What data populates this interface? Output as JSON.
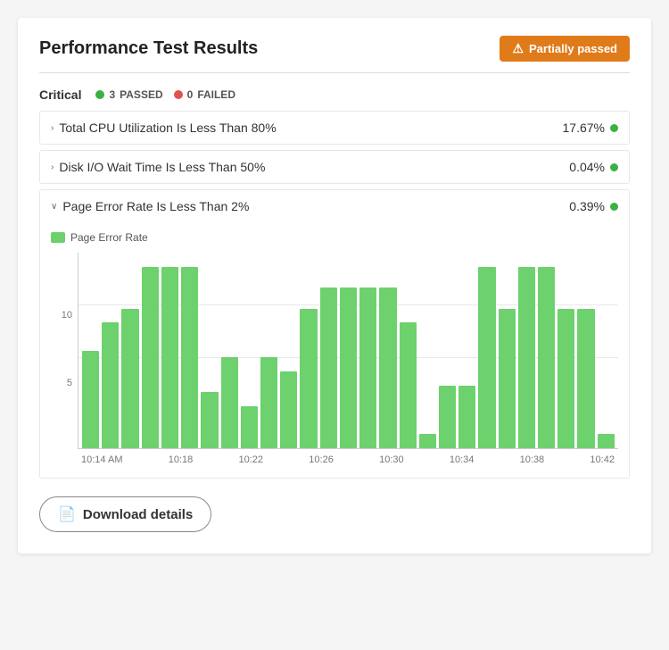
{
  "page": {
    "title": "Performance Test Results"
  },
  "status_badge": {
    "label": "Partially passed",
    "icon": "⚠"
  },
  "critical_section": {
    "label": "Critical",
    "passed": {
      "count": "3",
      "label": "PASSED"
    },
    "failed": {
      "count": "0",
      "label": "FAILED"
    }
  },
  "tests": [
    {
      "id": "cpu",
      "label": "Total CPU Utilization Is Less Than 80%",
      "value": "17.67%",
      "expanded": false,
      "chevron": "›"
    },
    {
      "id": "disk",
      "label": "Disk I/O Wait Time Is Less Than 50%",
      "value": "0.04%",
      "expanded": false,
      "chevron": "›"
    },
    {
      "id": "page_error",
      "label": "Page Error Rate Is Less Than 2%",
      "value": "0.39%",
      "expanded": true,
      "chevron": "∨"
    }
  ],
  "chart": {
    "legend_label": "Page Error Rate",
    "y_labels": [
      "",
      "10",
      "5",
      ""
    ],
    "x_labels": [
      "10:14 AM",
      "10:18",
      "10:22",
      "10:26",
      "10:30",
      "10:34",
      "10:38",
      "10:42"
    ],
    "bars": [
      7,
      9,
      10,
      13,
      13,
      13,
      4,
      6.5,
      3,
      6.5,
      5.5,
      10,
      11.5,
      11.5,
      11.5,
      11.5,
      9,
      1,
      4.5,
      4.5,
      13,
      10,
      13,
      13,
      10,
      10,
      1
    ]
  },
  "download_button": {
    "label": "Download details"
  }
}
